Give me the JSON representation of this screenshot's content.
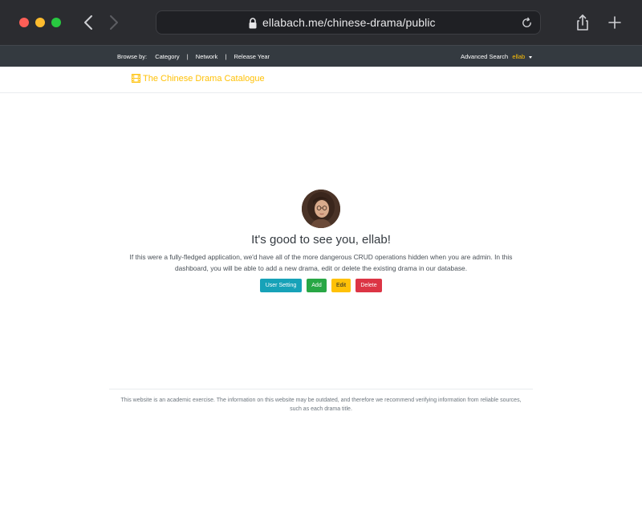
{
  "browser": {
    "url": "ellabach.me/chinese-drama/public"
  },
  "topbar": {
    "browse_label": "Browse by:",
    "links": [
      "Category",
      "Network",
      "Release Year"
    ],
    "separator": "|",
    "advanced_search": "Advanced Search",
    "user": "ellab"
  },
  "brand": {
    "title": "The Chinese Drama Catalogue",
    "color": "#ffc107"
  },
  "main": {
    "greeting": "It's good to see you, ellab!",
    "description": "If this were a fully-fledged application, we'd have all of the more dangerous CRUD operations hidden when you are admin. In this dashboard, you will be able to add a new drama, edit or delete the existing drama in our database.",
    "buttons": {
      "user_setting": "User Setting",
      "add": "Add",
      "edit": "Edit",
      "delete": "Delete"
    }
  },
  "footer": {
    "text": "This website is an academic exercise. The information on this website may be outdated, and therefore we recommend verifying information from reliable sources, such as each drama title."
  },
  "colors": {
    "navbar": "#343a40",
    "info": "#17a2b8",
    "success": "#28a745",
    "warning": "#ffc107",
    "danger": "#dc3545"
  }
}
